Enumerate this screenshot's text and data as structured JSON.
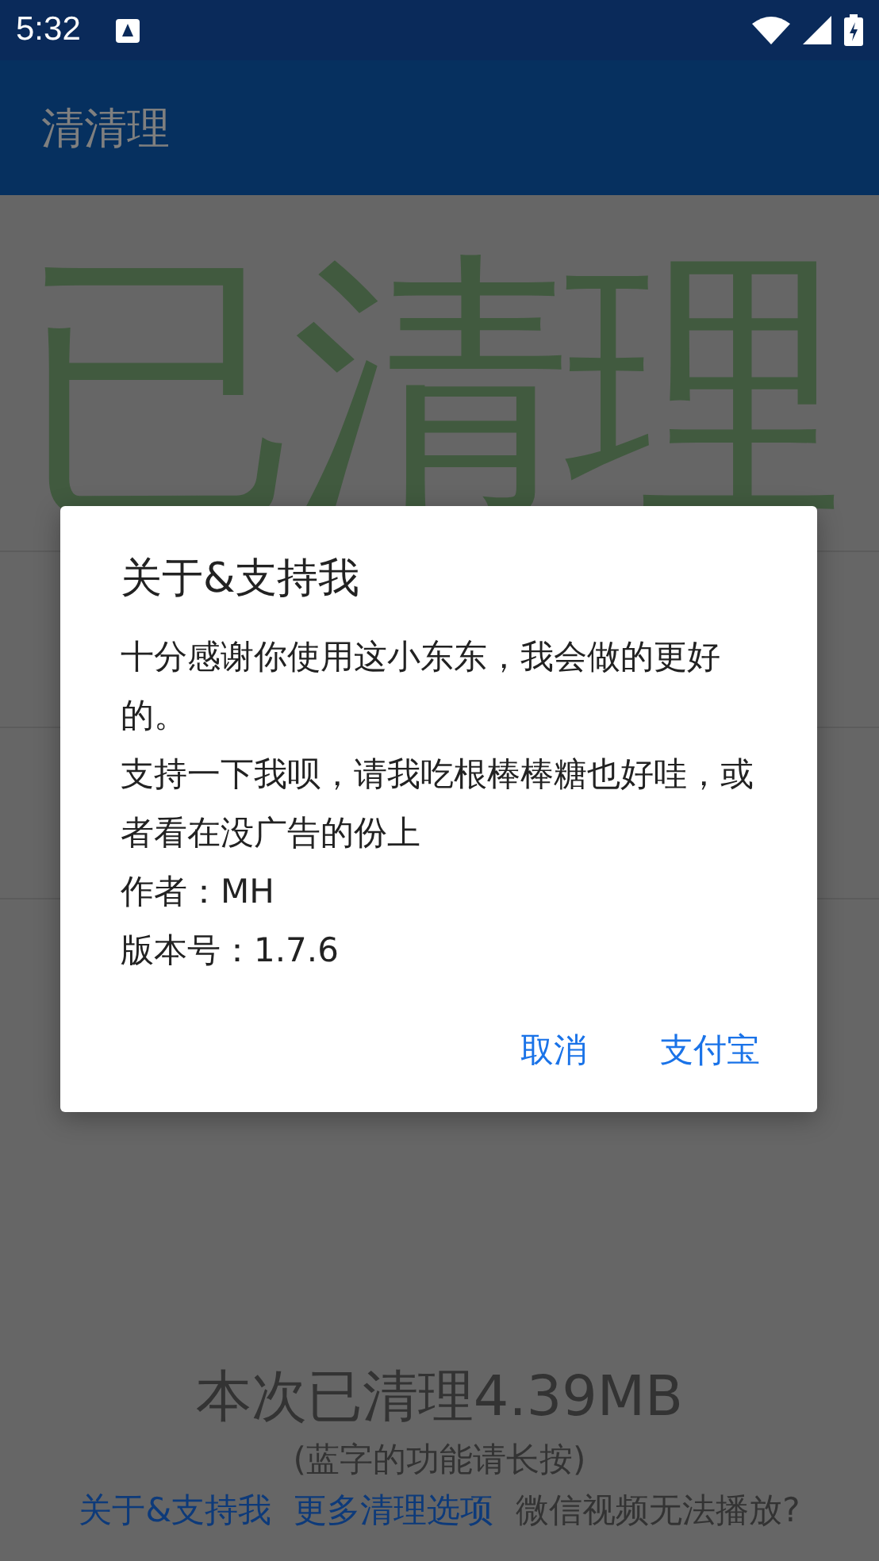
{
  "status_bar": {
    "time": "5:32"
  },
  "app_bar": {
    "title": "清清理"
  },
  "main": {
    "headline": "已清理",
    "summary": "本次已清理4.39MB",
    "hint": "(蓝字的功能请长按)",
    "links": [
      {
        "label": "关于&支持我",
        "kind": "link"
      },
      {
        "label": "更多清理选项",
        "kind": "link"
      },
      {
        "label": "微信视频无法播放?",
        "kind": "plain"
      }
    ]
  },
  "dialog": {
    "title": "关于&支持我",
    "lines": [
      "十分感谢你使用这小东东，我会做的更好的。",
      "支持一下我呗，请我吃根棒棒糖也好哇，或者看在没广告的份上",
      "作者：MH",
      "版本号：1.7.6"
    ],
    "buttons": [
      "取消",
      "支付宝"
    ]
  }
}
